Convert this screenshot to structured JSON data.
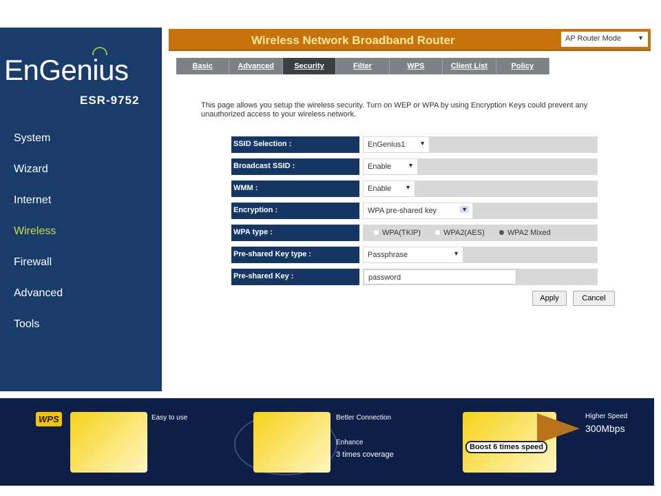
{
  "brand": {
    "logo": "EnGenius",
    "model": "ESR-9752"
  },
  "sidebar": {
    "items": [
      {
        "label": "System"
      },
      {
        "label": "Wizard"
      },
      {
        "label": "Internet"
      },
      {
        "label": "Wireless"
      },
      {
        "label": "Firewall"
      },
      {
        "label": "Advanced"
      },
      {
        "label": "Tools"
      }
    ]
  },
  "header": {
    "title": "Wireless Network Broadband Router",
    "mode": "AP Router Mode"
  },
  "tabs": [
    {
      "label": "Basic"
    },
    {
      "label": "Advanced"
    },
    {
      "label": "Security"
    },
    {
      "label": "Filter"
    },
    {
      "label": "WPS"
    },
    {
      "label": "Client List"
    },
    {
      "label": "Policy"
    }
  ],
  "description": "This page allows you setup the wireless security. Turn on WEP or WPA by using Encryption Keys could prevent any unauthorized access to your wireless network.",
  "form": {
    "ssid": {
      "label": "SSID Selection :",
      "value": "EnGenius1"
    },
    "broadcast": {
      "label": "Broadcast SSID :",
      "value": "Enable"
    },
    "wmm": {
      "label": "WMM :",
      "value": "Enable"
    },
    "encryption": {
      "label": "Encryption :",
      "value": "WPA pre-shared key"
    },
    "wpa_type": {
      "label": "WPA type :",
      "options": [
        "WPA(TKIP)",
        "WPA2(AES)",
        "WPA2 Mixed"
      ],
      "selected": "WPA2 Mixed"
    },
    "psk_type": {
      "label": "Pre-shared Key type :",
      "value": "Passphrase"
    },
    "psk": {
      "label": "Pre-shared Key :",
      "value": "password"
    }
  },
  "buttons": {
    "apply": "Apply",
    "cancel": "Cancel"
  },
  "banner": {
    "wps": "WPS",
    "easy": "Easy to use",
    "better": "Better Connection",
    "enhance": "Enhance",
    "coverage": "3 times coverage",
    "boost": "Boost 6 times speed",
    "higher": "Higher Speed",
    "speed": "300Mbps"
  }
}
